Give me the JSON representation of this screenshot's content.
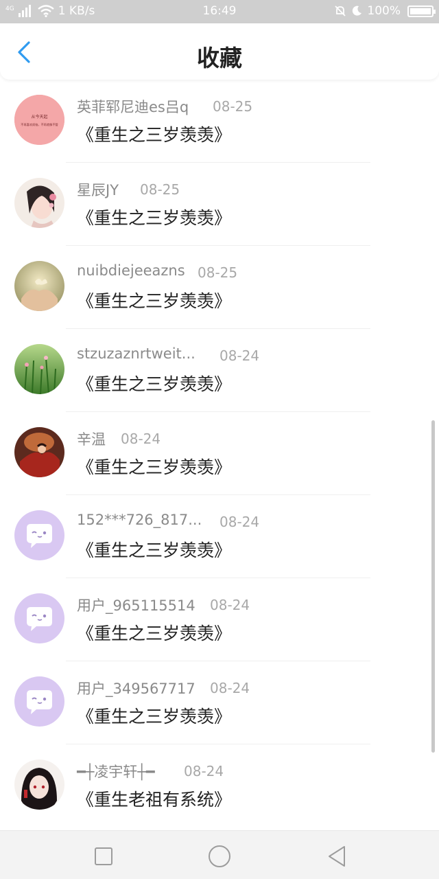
{
  "status_bar": {
    "network": "4G",
    "speed": "1 KB/s",
    "time": "16:49",
    "battery": "100%"
  },
  "header": {
    "title": "收藏",
    "back_icon": "chevron-left-icon",
    "accent_color": "#2f9bf0"
  },
  "favorites": [
    {
      "name": "英菲郓尼迪es吕q",
      "date": "08-25",
      "book": "《重生之三岁羡羡》",
      "avatar": "avatar-text-pink",
      "avatar_text_1": "从今天起",
      "avatar_text_2": "不再喜欢烦恼，不再就像不管",
      "name_width": 182
    },
    {
      "name": "星辰JY",
      "date": "08-25",
      "book": "《重生之三岁羡羡》",
      "avatar": "avatar-girl-portrait",
      "name_width": 80
    },
    {
      "name": "nuibdiejeeazns",
      "date": "08-25",
      "book": "《重生之三岁羡羡》",
      "avatar": "avatar-hands-butterfly",
      "name_width": 158
    },
    {
      "name": "stzuzaznrtweit...",
      "date": "08-24",
      "book": "《重生之三岁羡羡》",
      "avatar": "avatar-green-grass",
      "name_width": 196
    },
    {
      "name": "辛温",
      "date": "08-24",
      "book": "《重生之三岁羡羡》",
      "avatar": "avatar-red-figure",
      "name_width": 52
    },
    {
      "name": "152***726_817...",
      "date": "08-24",
      "book": "《重生之三岁羡羡》",
      "avatar": "avatar-default-chat",
      "name_width": 196
    },
    {
      "name": "用户_965115514",
      "date": "08-24",
      "book": "《重生之三岁羡羡》",
      "avatar": "avatar-default-chat",
      "name_width": 182
    },
    {
      "name": "用户_349567717",
      "date": "08-24",
      "book": "《重生之三岁羡羡》",
      "avatar": "avatar-default-chat",
      "name_width": 182
    },
    {
      "name": "━┼凌宇轩┼━",
      "date": "08-24",
      "book": "《重生老祖有系统》",
      "avatar": "avatar-anime-boy",
      "name_width": 142
    }
  ],
  "nav_bar": {
    "recent_icon": "square-icon",
    "home_icon": "circle-icon",
    "back_icon": "triangle-back-icon"
  }
}
